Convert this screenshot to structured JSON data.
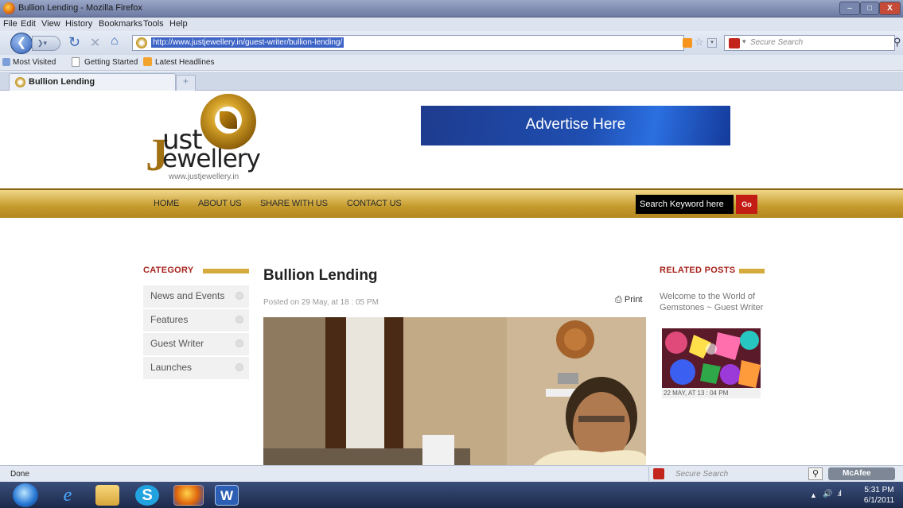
{
  "window": {
    "title": "Bullion Lending - Mozilla Firefox",
    "controls": {
      "minimize": "–",
      "maximize": "□",
      "close": "X"
    }
  },
  "menu": [
    "File",
    "Edit",
    "View",
    "History",
    "Bookmarks",
    "Tools",
    "Help"
  ],
  "nav": {
    "url": "http://www.justjewellery.in/guest-writer/bullion-lending/",
    "search_placeholder": "Secure Search"
  },
  "bookmarks": [
    "Most Visited",
    "Getting Started",
    "Latest Headlines"
  ],
  "tab": {
    "label": "Bullion Lending",
    "new_tab": "+"
  },
  "site": {
    "logo_lines": [
      "ust",
      "ewellery"
    ],
    "logo_url": "www.justjewellery.in",
    "advert": "Advertise Here",
    "nav": [
      "HOME",
      "ABOUT US",
      "SHARE WITH US",
      "CONTACT US"
    ],
    "search_placeholder": "Search Keyword here",
    "go": "Go"
  },
  "sidebar": {
    "heading": "CATEGORY",
    "items": [
      "News and Events",
      "Features",
      "Guest Writer",
      "Launches"
    ]
  },
  "post": {
    "title": "Bullion Lending",
    "meta": "Posted on 29 May, at 18 : 05 PM",
    "print": "Print"
  },
  "related": {
    "heading": "RELATED POSTS",
    "title": "Welcome to the World of Gemstones ~ Guest Writer",
    "date": "22 MAY, AT 13 : 04 PM"
  },
  "status": {
    "text": "Done",
    "secure_search": "Secure Search",
    "mcafee": "McAfee"
  },
  "taskbar": {
    "time": "5:31 PM",
    "date": "6/1/2011"
  }
}
